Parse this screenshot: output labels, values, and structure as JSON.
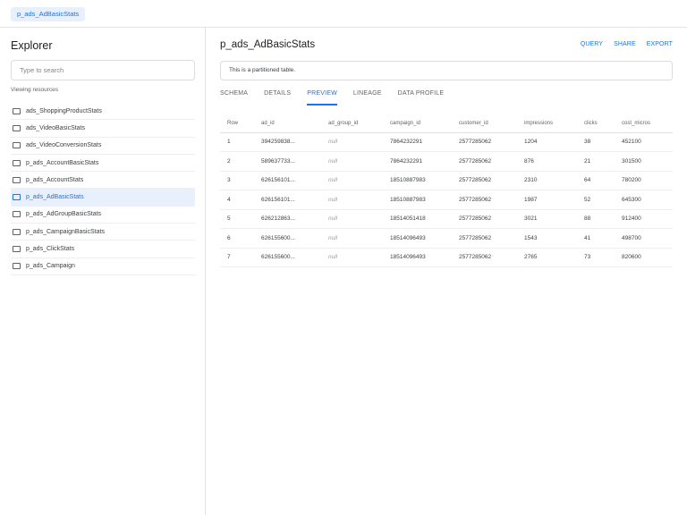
{
  "topbar": {
    "tab_label": "p_ads_AdBasicStats"
  },
  "sidebar": {
    "title": "Explorer",
    "search_placeholder": "Type to search",
    "viewing_label": "Viewing resources",
    "items": [
      {
        "label": "ads_ShoppingProductStats",
        "active": false
      },
      {
        "label": "ads_VideoBasicStats",
        "active": false
      },
      {
        "label": "ads_VideoConversionStats",
        "active": false
      },
      {
        "label": "p_ads_AccountBasicStats",
        "active": false
      },
      {
        "label": "p_ads_AccountStats",
        "active": false
      },
      {
        "label": "p_ads_AdBasicStats",
        "active": true
      },
      {
        "label": "p_ads_AdGroupBasicStats",
        "active": false
      },
      {
        "label": "p_ads_CampaignBasicStats",
        "active": false
      },
      {
        "label": "p_ads_ClickStats",
        "active": false
      },
      {
        "label": "p_ads_Campaign",
        "active": false
      }
    ]
  },
  "main": {
    "title": "p_ads_AdBasicStats",
    "actions": [
      "QUERY",
      "SHARE",
      "EXPORT"
    ],
    "info": "This is a partitioned table.",
    "tabs": [
      {
        "label": "SCHEMA",
        "active": false
      },
      {
        "label": "DETAILS",
        "active": false
      },
      {
        "label": "PREVIEW",
        "active": true
      },
      {
        "label": "LINEAGE",
        "active": false
      },
      {
        "label": "DATA PROFILE",
        "active": false
      }
    ],
    "table": {
      "columns": [
        "Row",
        "ad_id",
        "ad_group_id",
        "campaign_id",
        "customer_id",
        "impressions",
        "clicks",
        "cost_micros"
      ],
      "rows": [
        [
          "1",
          "394259838...",
          "null",
          "7864232291",
          "2577285062",
          "1204",
          "38",
          "452100"
        ],
        [
          "2",
          "589637733...",
          "null",
          "7864232291",
          "2577285062",
          "876",
          "21",
          "301500"
        ],
        [
          "3",
          "626156101...",
          "null",
          "18510887983",
          "2577285062",
          "2310",
          "64",
          "780200"
        ],
        [
          "4",
          "626156101...",
          "null",
          "18510887983",
          "2577285062",
          "1987",
          "52",
          "645300"
        ],
        [
          "5",
          "626212863...",
          "null",
          "18514051418",
          "2577285062",
          "3021",
          "88",
          "912400"
        ],
        [
          "6",
          "626155600...",
          "null",
          "18514096493",
          "2577285062",
          "1543",
          "41",
          "498700"
        ],
        [
          "7",
          "626155600...",
          "null",
          "18514096493",
          "2577285062",
          "2765",
          "73",
          "820600"
        ]
      ]
    }
  },
  "colors": {
    "accent": "#1a73e8",
    "active_bg": "#e8f0fe",
    "border": "#e3e3e3"
  }
}
